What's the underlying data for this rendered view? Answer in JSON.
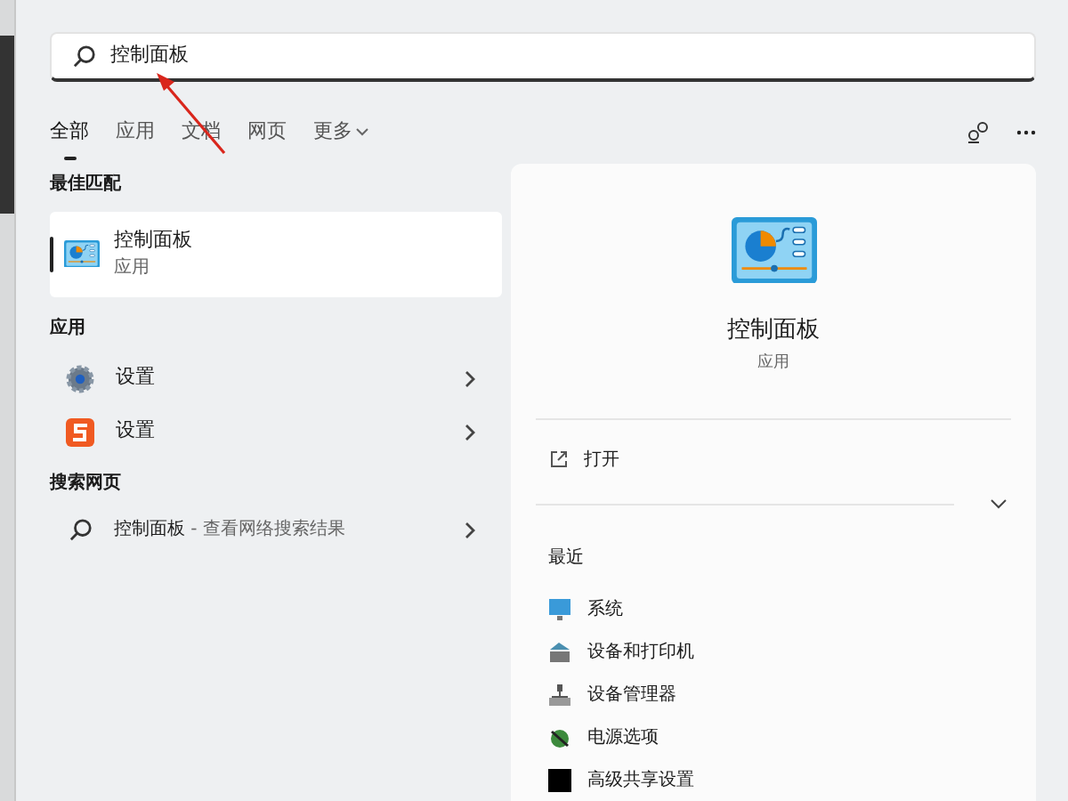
{
  "search": {
    "value": "控制面板"
  },
  "tabs": [
    {
      "label": "全部",
      "selected": true
    },
    {
      "label": "应用",
      "selected": false
    },
    {
      "label": "文档",
      "selected": false
    },
    {
      "label": "网页",
      "selected": false
    },
    {
      "label": "更多",
      "selected": false
    }
  ],
  "best_match": {
    "heading": "最佳匹配",
    "title": "控制面板",
    "subtitle": "应用",
    "selected": true
  },
  "apps": {
    "heading": "应用",
    "items": [
      {
        "label": "设置",
        "kind": "gear"
      },
      {
        "label": "设置",
        "kind": "sogou"
      }
    ]
  },
  "web": {
    "heading": "搜索网页",
    "query": "控制面板",
    "hint": " - 查看网络搜索结果"
  },
  "detail": {
    "title": "控制面板",
    "subtitle": "应用",
    "action": "打开",
    "recent_heading": "最近",
    "recent": [
      "系统",
      "设备和打印机",
      "设备管理器",
      "电源选项",
      "高级共享设置"
    ]
  }
}
